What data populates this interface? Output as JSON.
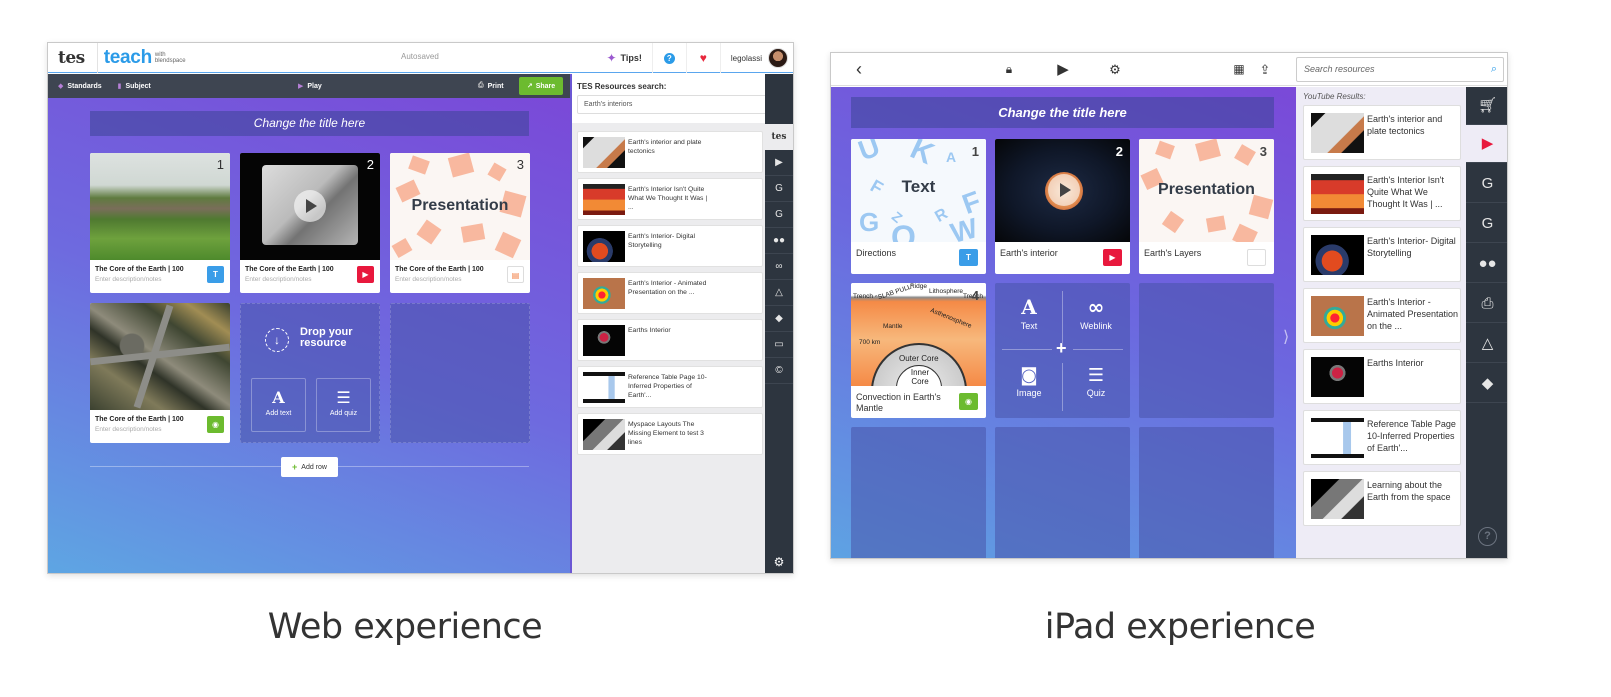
{
  "captions": {
    "web": "Web experience",
    "ipad": "iPad experience"
  },
  "web": {
    "header": {
      "logo_tes": "tes",
      "logo_teach": "teach",
      "logo_with": "with blendspace",
      "status": "Autosaved",
      "tips_label": "Tips!",
      "help_icon": "?",
      "favorite_icon": "♥",
      "username": "legolassi"
    },
    "toolbar": {
      "standards": "Standards",
      "subject": "Subject",
      "play": "Play",
      "print": "Print",
      "share": "Share"
    },
    "canvas": {
      "title": "Change the title here",
      "cards": [
        {
          "number": "1",
          "title": "The Core of the Earth | 100",
          "desc": "Enter description/notes",
          "type": "text",
          "badge": "T"
        },
        {
          "number": "2",
          "title": "The Core of the Earth | 100",
          "desc": "Enter description/notes",
          "type": "youtube",
          "badge": "▶"
        },
        {
          "number": "3",
          "title": "The Core of the Earth | 100",
          "desc": "Enter description/notes",
          "type": "presentation",
          "badge": "▤",
          "thumb_label": "Presentation"
        },
        {
          "number": "",
          "title": "The Core of the Earth | 100",
          "desc": "Enter description/notes",
          "type": "image",
          "badge": "◉"
        }
      ],
      "drop": {
        "label": "Drop your resource",
        "add_text": "Add text",
        "add_quiz": "Add quiz"
      },
      "add_row": "Add row"
    },
    "sidebar": {
      "label": "TES Resources search:",
      "search_value": "Earth's interiors",
      "results": [
        {
          "title": "Earth's interior and plate tectonics"
        },
        {
          "title": "Earth's Interior Isn't Quite What We Thought It Was | ..."
        },
        {
          "title": "Earth's Interior- Digital Storytelling"
        },
        {
          "title": "Earth's Interior - Animated Presentation on the ..."
        },
        {
          "title": "Earths Interior"
        },
        {
          "title": "Reference Table Page 10-Inferred Properties of Earth'..."
        },
        {
          "title": "Myspace Layouts The Missing Element to test 3 lines"
        }
      ]
    },
    "strip": {
      "tes_label": "tes",
      "icons": [
        "youtube-icon",
        "google-search-icon",
        "google-image-icon",
        "flickr-icon",
        "weblink-icon",
        "google-drive-icon",
        "dropbox-icon",
        "presentation-icon",
        "copyright-icon"
      ]
    }
  },
  "ipad": {
    "search_placeholder": "Search resources",
    "canvas": {
      "title": "Change the title here",
      "cards": [
        {
          "number": "1",
          "title": "Directions",
          "type": "text",
          "badge": "T",
          "thumb_label": "Text"
        },
        {
          "number": "2",
          "title": "Earth's interior",
          "type": "youtube",
          "badge": "▶"
        },
        {
          "number": "3",
          "title": "Earth's Layers",
          "type": "presentation",
          "badge": "▤",
          "thumb_label": "Presentation"
        },
        {
          "number": "4",
          "title": "Convection in Earth's Mantle",
          "type": "image",
          "badge": "◉"
        }
      ],
      "mantle_labels": {
        "trench_left": "Trench",
        "slab_pull": "\"SLAB PULL\"",
        "ridge": "Ridge",
        "lithosphere": "Lithosphere",
        "trench_right": "Trench",
        "mantle": "Mantle",
        "asthenosphere": "Asthenosphere",
        "depth": "700 km",
        "outer_core": "Outer Core",
        "inner_core": "Inner Core"
      },
      "add_menu": {
        "text": "Text",
        "weblink": "Weblink",
        "image": "Image",
        "quiz": "Quiz"
      }
    },
    "sidebar": {
      "label": "YouTube Results:",
      "results": [
        {
          "title": "Earth's interior and plate tectonics"
        },
        {
          "title": "Earth's Interior Isn't Quite What We Thought It Was | ..."
        },
        {
          "title": "Earth's Interior- Digital Storytelling"
        },
        {
          "title": "Earth's Interior - Animated Presentation on the ..."
        },
        {
          "title": "Earths Interior"
        },
        {
          "title": "Reference Table Page 10-Inferred Properties of Earth'..."
        },
        {
          "title": "Learning about the Earth from the space"
        }
      ]
    },
    "strip": {
      "active": "youtube",
      "icons": [
        "cart-icon",
        "youtube-icon",
        "google-search-icon",
        "google-image-icon",
        "flickr-icon",
        "printer-icon",
        "google-drive-icon",
        "dropbox-icon"
      ]
    }
  },
  "colors": {
    "accent_blue": "#2b9be8",
    "share_green": "#6cbb2f",
    "youtube_red": "#e8183d",
    "toolbar_dark": "#3e4551"
  }
}
